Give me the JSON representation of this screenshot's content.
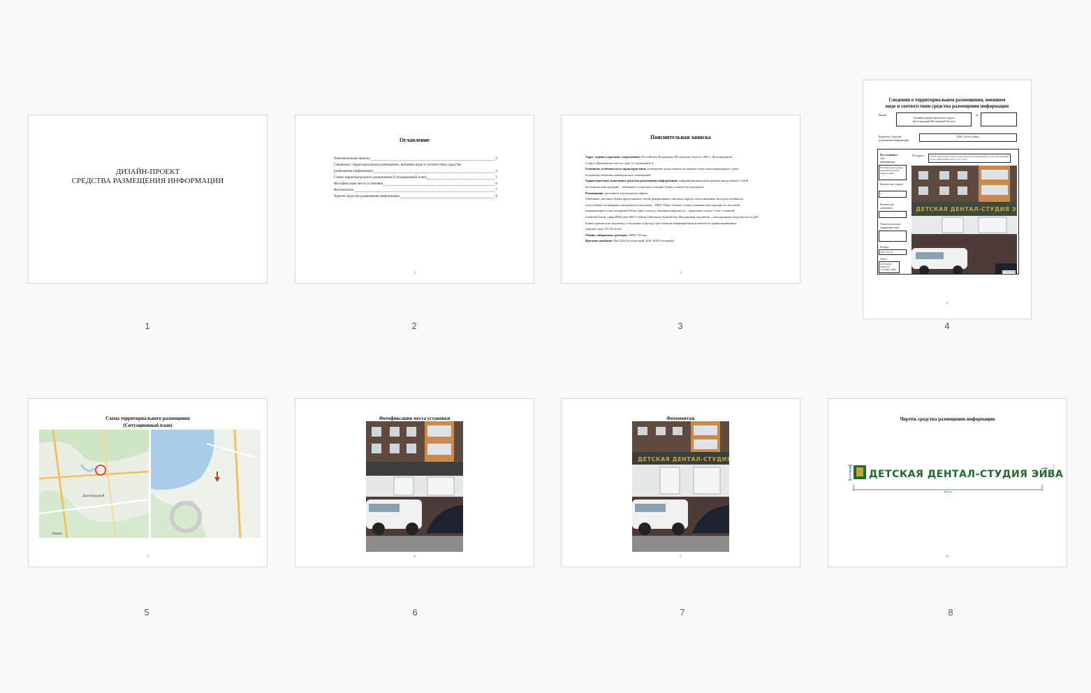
{
  "pages": [
    {
      "number": "1",
      "cover_line1": "ДИЗАЙН-ПРОЕКТ",
      "cover_line2": "СРЕДСТВА РАЗМЕЩЕНИЯ ИНФОРМАЦИИ"
    },
    {
      "number": "2",
      "footer": "2",
      "title": "Оглавление",
      "toc": [
        {
          "text": "Пояснительная записка",
          "page": "3"
        },
        {
          "text": "Сведения о территориальном размещении, внешнем виде и соответствии средства",
          "page": ""
        },
        {
          "text": "размещения информации",
          "page": "4"
        },
        {
          "text": "Схема территориального размещения  (Ситуационный план)",
          "page": "5"
        },
        {
          "text": "Фотофиксация места установки",
          "page": "6"
        },
        {
          "text": "Фотомонтаж",
          "page": "7"
        },
        {
          "text": "Чертеж средства размещения информации",
          "page": "8"
        }
      ]
    },
    {
      "number": "3",
      "footer": "3",
      "title": "Пояснительная записка",
      "lines": [
        {
          "bold": "Адрес здания (строения, сооружения):",
          "text": " Российская Федерация, Московская область, МО г. Долгопрудный,"
        },
        {
          "bold": "",
          "text": "Старое Дмитровское шоссе, дом 11, помещение 5."
        },
        {
          "bold": "Основные особенности и характеристики:",
          "text": " помещение расположено на первом этаже многоквартирного дома"
        },
        {
          "bold": "",
          "text": "в границах нежилых коммерческих помещений."
        },
        {
          "bold": "Характеристика (описание) средства размещения информации:",
          "text": " информационная конструкция представляет собой"
        },
        {
          "bold": "",
          "text": "настенную конструкцию – объемные и отдельно стоящие буквы и знаки без подложки."
        },
        {
          "bold": "Размещение:",
          "text": " настенное, над входом в офисы."
        },
        {
          "bold": "",
          "text": "Объемные световые буквы представляют собой декоративные световые короба, изготовленные методом склейки из"
        },
        {
          "bold": "",
          "text": "огнестойких полимерных материалов (подложка – ПВХ 10мм, боковая стенка (лицевая конструкция из листовой"
        },
        {
          "bold": "",
          "text": "нержавеющей стали толщиной 0.8мм (цвет золото), лицевая поверхность – акриловое стекло 3 мм с пленкой"
        },
        {
          "bold": "",
          "text": "пленкой Oracal серия 8500 цвет 068. Глубина объемных букв 60 мм. Внутренняя подсветка – светодиодные модули класса ip67."
        },
        {
          "bold": "",
          "text": "Буквы крепятся на подложку, а подложка к фасаду при помощи анкерирующихся винтов из профилированных"
        },
        {
          "bold": "",
          "text": "сварных труб 25×25×2 мм."
        },
        {
          "bold": "Общие габаритные размеры:",
          "text": " 3800×750 мм."
        },
        {
          "bold": "Цветовое решение:",
          "text": " Ral 1034 (золотистый), RAL 6018 (зеленый)."
        }
      ]
    },
    {
      "number": "4",
      "footer": "4",
      "title_line1": "Сведения о территориальном размещении, внешнем",
      "title_line2": "виде и соответствии средства размещения информации",
      "issued_label": "Выдан",
      "issued_by_line1": "Администрация городского округа",
      "issued_by_line2": "Долгопрудный Московской области",
      "no_label": "№",
      "owner_label_line1": "Владелец Средства",
      "owner_label_line2": "размещения информации",
      "owner_value": "ООО «Золот Дент»",
      "install_label": "На установку:",
      "type_label": "Тип",
      "type_label2": "информации",
      "type_value": "Настенная конструкция. Объемные световые буквы и знаки.",
      "address_label": "По адресу",
      "address_value": "141700, Московская область, городской округ Долгопрудный, город Долгопрудный, Старое Дмитровское шоссе, д 11, пом 5",
      "qty_sides_label": "Количество сторон:",
      "qty_sides_value": "1",
      "qty_elements_label": "Количество элементов:",
      "tech_label": "Технологические характеристики:",
      "size_label": "Размер:",
      "size_value": "3800×750 мм.",
      "text_label": "Текст:",
      "text_value": "ДЕТСКАЯ ДЕНТАЛ-СТУДИЯ ЭЙВА",
      "photo_caption": "фотомонтаж"
    },
    {
      "number": "5",
      "footer": "5",
      "title_line1": "Схема территориального размещения",
      "title_line2": "(Ситуационный план)",
      "map_labels": [
        "Долгопрудный",
        "Химки"
      ]
    },
    {
      "number": "6",
      "footer": "6",
      "title": "Фотофиксация места установки"
    },
    {
      "number": "7",
      "footer": "7",
      "title": "Фотомонтаж",
      "sign_text": "ДЕТСКАЯ ДЕНТАЛ-СТУДИЯ ЭЙВА"
    },
    {
      "number": "8",
      "footer": "8",
      "title": "Чертёж средства размещения информации",
      "sign_text": "ДЕТСКАЯ ДЕНТАЛ-СТУДИЯ ЭЙВА",
      "dim_height": "750 мм",
      "dim_letter": "450 мм",
      "dim_width": "3800 мм"
    }
  ],
  "colors": {
    "sign_green": "#1e6b2d",
    "sign_gold": "#c9a23a",
    "brick": "#5a4a3e",
    "dim_line": "#2a5a8a"
  }
}
